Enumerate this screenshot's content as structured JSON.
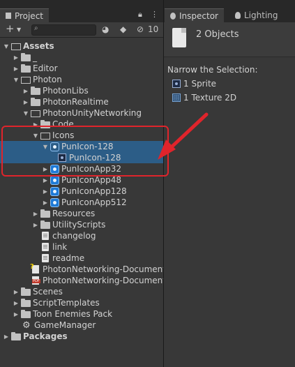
{
  "project_tab": {
    "label": "Project",
    "hidden_count": "10"
  },
  "inspector_tabs": [
    {
      "label": "Inspector"
    },
    {
      "label": "Lighting"
    }
  ],
  "toolbar": {
    "add_label": "+",
    "search_placeholder": ""
  },
  "tree": [
    {
      "label": "Assets",
      "bold": true
    },
    {
      "label": "_"
    },
    {
      "label": "Editor"
    },
    {
      "label": "Photon"
    },
    {
      "label": "PhotonLibs"
    },
    {
      "label": "PhotonRealtime"
    },
    {
      "label": "PhotonUnityNetworking"
    },
    {
      "label": "Code"
    },
    {
      "label": "Icons"
    },
    {
      "label": "PunIcon-128"
    },
    {
      "label": "PunIcon-128"
    },
    {
      "label": "PunIconApp32"
    },
    {
      "label": "PunIconApp48"
    },
    {
      "label": "PunIconApp128"
    },
    {
      "label": "PunIconApp512"
    },
    {
      "label": "Resources"
    },
    {
      "label": "UtilityScripts"
    },
    {
      "label": "changelog"
    },
    {
      "label": "link"
    },
    {
      "label": "readme"
    },
    {
      "label": "PhotonNetworking-Documentation"
    },
    {
      "label": "PhotonNetworking-Documentation"
    },
    {
      "label": "Scenes"
    },
    {
      "label": "ScriptTemplates"
    },
    {
      "label": "Toon Enemies Pack"
    },
    {
      "label": "GameManager"
    },
    {
      "label": "Packages",
      "bold": true
    }
  ],
  "inspector": {
    "title": "2 Objects",
    "narrow_label": "Narrow the Selection:",
    "items": [
      {
        "label": "1 Sprite"
      },
      {
        "label": "1 Texture 2D"
      }
    ]
  },
  "colors": {
    "selection": "#2c5d87",
    "annotation": "#e0242b"
  }
}
